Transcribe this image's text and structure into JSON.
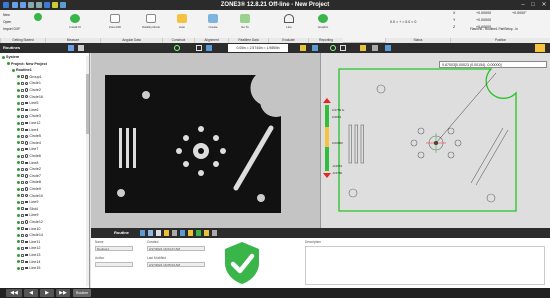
{
  "window": {
    "title": "ZONE3® 12.8.21 Off-line - New Project",
    "controls": [
      "–",
      "□",
      "✕"
    ]
  },
  "ribbon": {
    "file_items": [
      "New",
      "Open",
      "Import DXF"
    ],
    "buttons": [
      "Install III",
      "ZoneCDI",
      "DataSymbols",
      "Auto",
      "Create",
      "Go To",
      "Line",
      "Graphic"
    ],
    "groups": [
      "Getting Started",
      "Measure",
      "Angular Data",
      "Construct",
      "Alignment",
      "Realtime Data",
      "Evaluate",
      "Reporting",
      "Status",
      "Position"
    ],
    "status": {
      "left_line": "0.0 = + = 0.0 = 0",
      "right_line": "FlashVB - Routine1 PartSetup - ln"
    },
    "coords": [
      {
        "axis": "X",
        "value": "+0.00000",
        "extra": "+0.0000°"
      },
      {
        "axis": "Y",
        "value": "+0.00000",
        "extra": ""
      },
      {
        "axis": "Z",
        "value": "+0.00000",
        "extra": ""
      }
    ]
  },
  "toolbar": {
    "left_label": "Routines",
    "measure_readout": "0.00in = 2.5744in = 1.9850in"
  },
  "tree": {
    "items": [
      {
        "label": "System",
        "level": 0,
        "type": "root"
      },
      {
        "label": "Project: New Project",
        "level": 1,
        "type": "root"
      },
      {
        "label": "Routine1",
        "level": 2,
        "type": "root"
      },
      {
        "label": "Group1",
        "level": 3,
        "type": "group"
      },
      {
        "label": "Circle1",
        "level": 3,
        "type": "circle"
      },
      {
        "label": "Circle2",
        "level": 3,
        "type": "circle"
      },
      {
        "label": "Circle16",
        "level": 3,
        "type": "circle"
      },
      {
        "label": "Line5",
        "level": 3,
        "type": "line"
      },
      {
        "label": "Line6",
        "level": 3,
        "type": "line"
      },
      {
        "label": "Circle3",
        "level": 3,
        "type": "circle"
      },
      {
        "label": "Line12",
        "level": 3,
        "type": "line"
      },
      {
        "label": "Line4",
        "level": 3,
        "type": "line"
      },
      {
        "label": "Circle5",
        "level": 3,
        "type": "circle"
      },
      {
        "label": "Circle4",
        "level": 3,
        "type": "circle"
      },
      {
        "label": "Line7",
        "level": 3,
        "type": "line"
      },
      {
        "label": "Circle6",
        "level": 3,
        "type": "circle"
      },
      {
        "label": "Line8",
        "level": 3,
        "type": "line"
      },
      {
        "label": "Circle2",
        "level": 3,
        "type": "circle"
      },
      {
        "label": "Circle7",
        "level": 3,
        "type": "circle"
      },
      {
        "label": "Circle8",
        "level": 3,
        "type": "circle"
      },
      {
        "label": "Circle9",
        "level": 3,
        "type": "circle"
      },
      {
        "label": "Circle10",
        "level": 3,
        "type": "circle"
      },
      {
        "label": "Line9",
        "level": 3,
        "type": "line"
      },
      {
        "label": "Slot4",
        "level": 3,
        "type": "line"
      },
      {
        "label": "Line9",
        "level": 3,
        "type": "line"
      },
      {
        "label": "Circle12",
        "level": 3,
        "type": "circle"
      },
      {
        "label": "Line10",
        "level": 3,
        "type": "line"
      },
      {
        "label": "Circle14",
        "level": 3,
        "type": "circle"
      },
      {
        "label": "Line11",
        "level": 3,
        "type": "line"
      },
      {
        "label": "Line12",
        "level": 3,
        "type": "line"
      },
      {
        "label": "Line13",
        "level": 3,
        "type": "line"
      },
      {
        "label": "Line14",
        "level": 3,
        "type": "line"
      },
      {
        "label": "Line15",
        "level": 3,
        "type": "line"
      }
    ]
  },
  "cad": {
    "readout": "0.67003[0.00023 (0.00154) -0.00000]",
    "gauge_values": [
      "0.0750 lo",
      "0.0051",
      "0.00000",
      "-0.0051",
      "-0.0750"
    ]
  },
  "bottom": {
    "label": "Routine",
    "props": {
      "name_label": "Name",
      "name_value": "Routine1",
      "author_label": "Author",
      "author_value": "",
      "created_label": "Created",
      "created_value": "2/17/2021 16:04:27 AM",
      "modified_label": "Last Modified",
      "modified_value": "2/17/2021 16:05:03 AM",
      "description_label": "Description"
    }
  },
  "status": {
    "run_label": "Routine"
  },
  "colors": {
    "accent_green": "#39b54a",
    "dark": "#2c2c2c",
    "cad_green": "#26c426"
  }
}
